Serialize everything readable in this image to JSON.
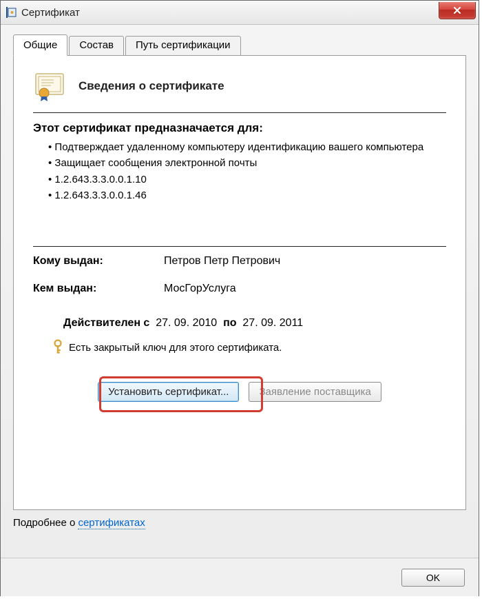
{
  "window": {
    "title": "Сертификат"
  },
  "tabs": [
    {
      "label": "Общие",
      "active": true
    },
    {
      "label": "Состав",
      "active": false
    },
    {
      "label": "Путь сертификации",
      "active": false
    }
  ],
  "cert": {
    "heading": "Сведения о сертификате",
    "purpose_title": "Этот сертификат предназначается для:",
    "purposes": [
      "Подтверждает удаленному компьютеру идентификацию вашего компьютера",
      "Защищает сообщения электронной почты",
      "1.2.643.3.3.0.0.1.10",
      "1.2.643.3.3.0.0.1.46"
    ],
    "issued_to_label": "Кому выдан:",
    "issued_to": "Петров Петр Петрович",
    "issued_by_label": "Кем выдан:",
    "issued_by": "МосГорУслуга",
    "valid_prefix": "Действителен с",
    "valid_from": "27. 09. 2010",
    "valid_mid": "по",
    "valid_to": "27. 09. 2011",
    "private_key_text": "Есть закрытый ключ для этого сертификата."
  },
  "buttons": {
    "install": "Установить сертификат...",
    "issuer_statement": "Заявление поставщика",
    "ok": "OK"
  },
  "learn_more": {
    "prefix": "Подробнее о ",
    "link": "сертификатах"
  },
  "icons": {
    "certificate": "certificate-icon",
    "key": "key-icon",
    "close": "close-icon",
    "app": "app-icon"
  }
}
